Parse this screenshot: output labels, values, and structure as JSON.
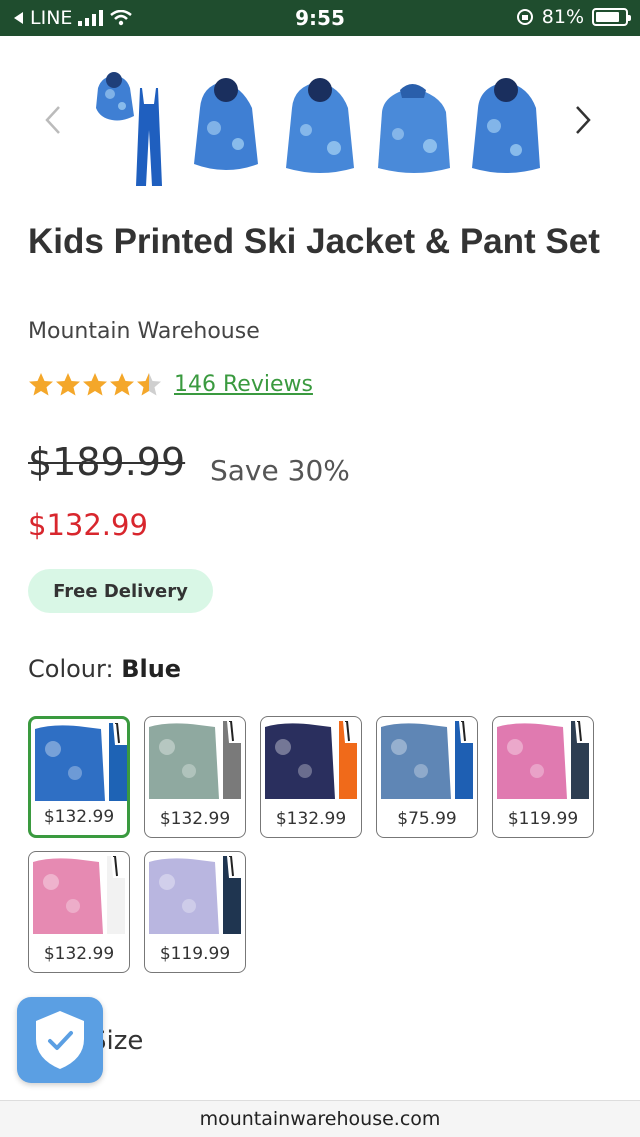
{
  "status_bar": {
    "carrier": "LINE",
    "time": "9:55",
    "battery_percent": "81%",
    "battery_level": 0.81
  },
  "gallery": {
    "prev_icon": "chevron-left-icon",
    "next_icon": "chevron-right-icon",
    "thumbnail_count": 5
  },
  "product": {
    "title": "Kids Printed Ski Jacket & Pant Set",
    "brand": "Mountain Warehouse",
    "rating": 4.5,
    "reviews_label": "146 Reviews",
    "old_price": "$189.99",
    "save_label": "Save 30%",
    "price": "$132.99",
    "delivery_badge": "Free Delivery"
  },
  "colour": {
    "label": "Colour:",
    "selected": "Blue",
    "swatches": [
      {
        "price": "$132.99",
        "jacket": "#2f6fc4",
        "pants": "#1e63b5"
      },
      {
        "price": "$132.99",
        "jacket": "#8fa9a0",
        "pants": "#7a7a7a"
      },
      {
        "price": "$132.99",
        "jacket": "#2a2f5e",
        "pants": "#f06a1a"
      },
      {
        "price": "$75.99",
        "jacket": "#5f86b5",
        "pants": "#1e5fb3"
      },
      {
        "price": "$119.99",
        "jacket": "#e07ab0",
        "pants": "#2d3e52"
      },
      {
        "price": "$132.99",
        "jacket": "#e68ab2",
        "pants": "#f2f2f2"
      },
      {
        "price": "$119.99",
        "jacket": "#b9b6e0",
        "pants": "#1f3550"
      }
    ]
  },
  "size": {
    "label": "se a Size"
  },
  "url_bar": {
    "domain": "mountainwarehouse.com"
  },
  "colors": {
    "status_bar_bg": "#1f4d2e",
    "accent_green": "#3a9a3f",
    "sale_red": "#d8262d",
    "star_gold": "#f4a72a"
  }
}
